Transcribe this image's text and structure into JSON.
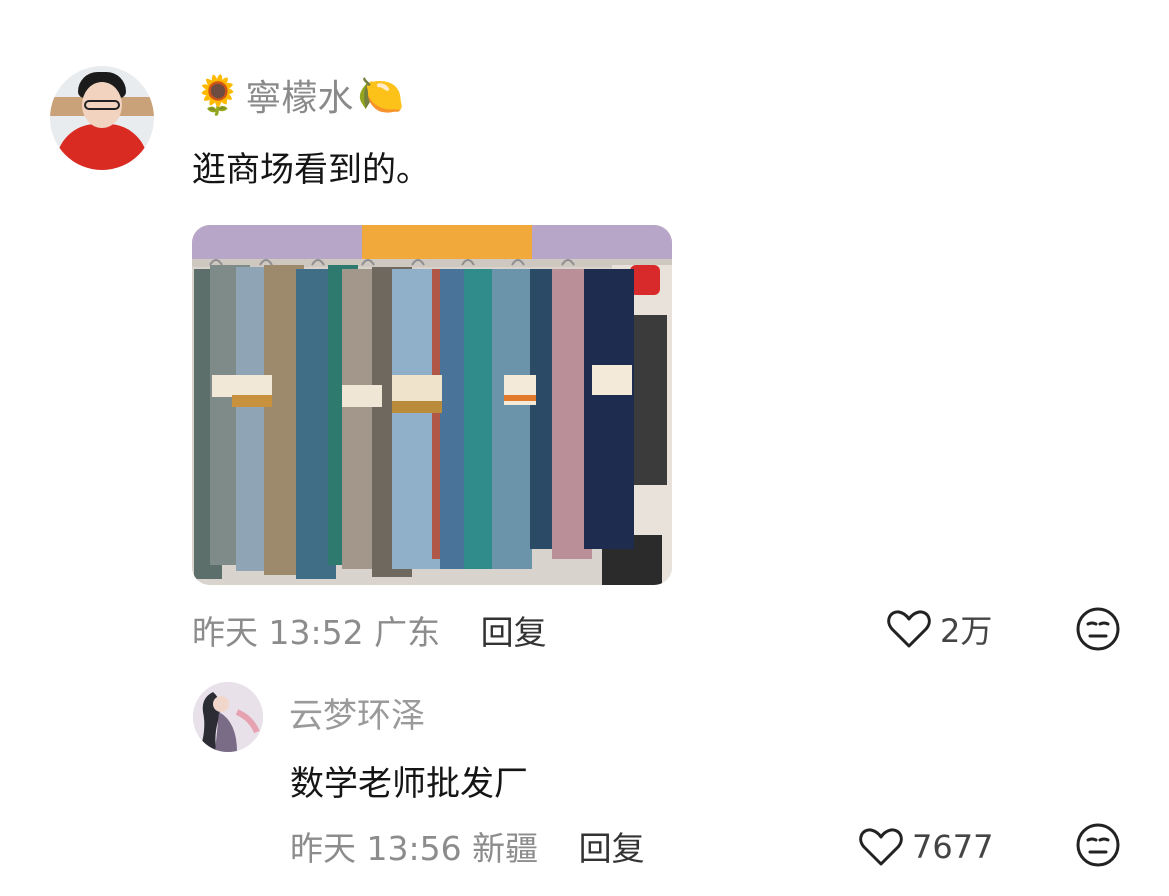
{
  "comment": {
    "user_name": "寧檬水",
    "name_prefix_emoji": "🌻",
    "name_suffix_emoji": "🍋",
    "text": "逛商场看到的。",
    "time": "昨天 13:52",
    "location": "广东",
    "reply_label": "回复",
    "likes": "2万"
  },
  "reply": {
    "user_name": "云梦环泽",
    "text": "数学老师批发厂",
    "time": "昨天 13:56",
    "location": "新疆",
    "reply_label": "回复",
    "likes": "7677"
  },
  "icons": {
    "like": "heart-outline-icon",
    "reaction": "neutral-face-icon"
  }
}
